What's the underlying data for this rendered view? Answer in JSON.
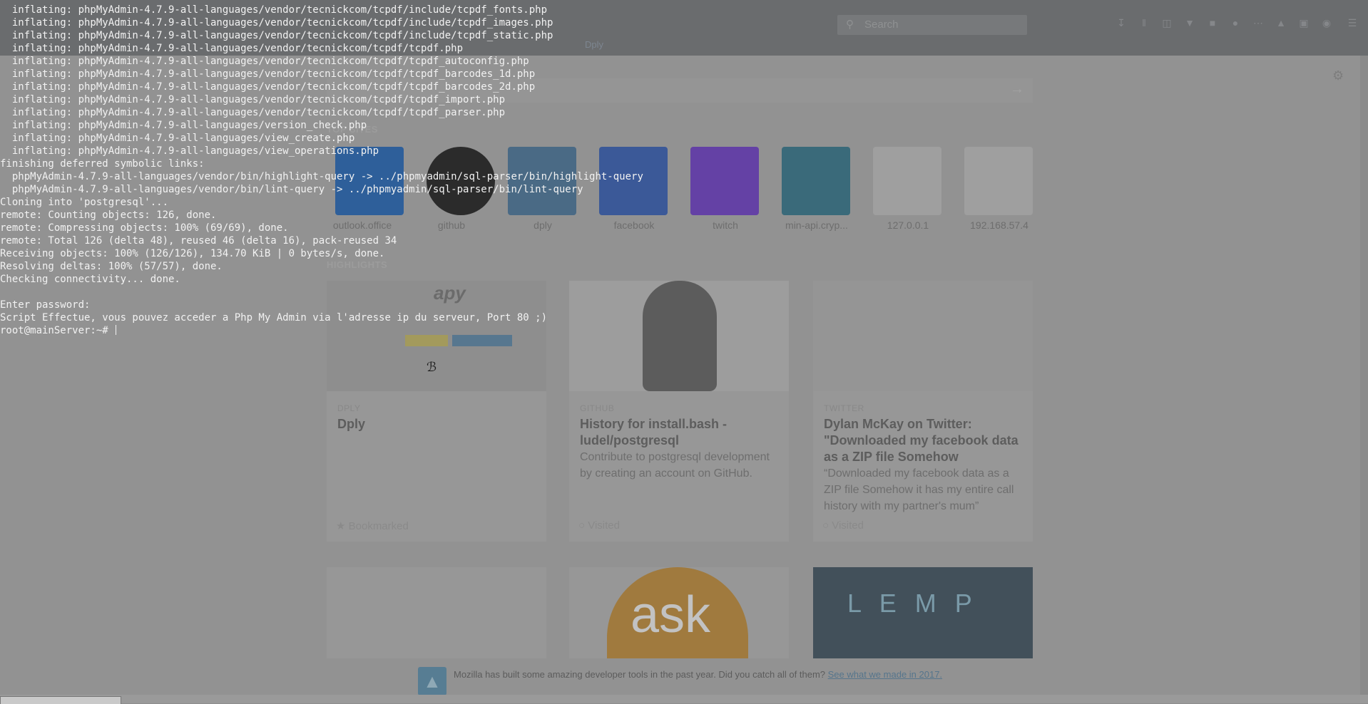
{
  "browser": {
    "search_placeholder": "Search",
    "tab_label": "Dply",
    "top_sites_heading": "TOP SITES",
    "highlights_heading": "HIGHLIGHTS",
    "top_sites": [
      {
        "label": "outlook.office",
        "color": "#2e5f9a"
      },
      {
        "label": "github",
        "color": "#2b2b2b"
      },
      {
        "label": "dply",
        "color": "#4a6a85"
      },
      {
        "label": "facebook",
        "color": "#3b5998"
      },
      {
        "label": "twitch",
        "color": "#6441a5"
      },
      {
        "label": "min-api.cryp...",
        "color": "#3a6a7a"
      },
      {
        "label": "127.0.0.1",
        "color": "#9f9f9f"
      },
      {
        "label": "192.168.57.4",
        "color": "#9f9f9f"
      }
    ],
    "highlights": [
      {
        "source": "DPLY",
        "title": "Dply",
        "description": "",
        "context": "Bookmarked",
        "thumb_text": "apy"
      },
      {
        "source": "GITHUB",
        "title": "History for install.bash - ludel/postgresql",
        "description": "Contribute to postgresql development by creating an account on GitHub.",
        "context": "Visited"
      },
      {
        "source": "TWITTER",
        "title": "Dylan McKay on Twitter: \"Downloaded my facebook data as a ZIP file Somehow",
        "description": "“Downloaded my facebook data as a ZIP file Somehow it has my entire call history with my partner's mum”",
        "context": "Visited"
      }
    ],
    "lower_tiles": [
      {
        "label": ""
      },
      {
        "label": "ask"
      },
      {
        "label": "L E M P"
      }
    ],
    "banner": {
      "message": "Mozilla has built some amazing developer tools in the past year. Did you catch all of them? ",
      "link": "See what we made in 2017."
    }
  },
  "terminal": {
    "lines": [
      "  inflating: phpMyAdmin-4.7.9-all-languages/vendor/tecnickcom/tcpdf/include/tcpdf_fonts.php",
      "  inflating: phpMyAdmin-4.7.9-all-languages/vendor/tecnickcom/tcpdf/include/tcpdf_images.php",
      "  inflating: phpMyAdmin-4.7.9-all-languages/vendor/tecnickcom/tcpdf/include/tcpdf_static.php",
      "  inflating: phpMyAdmin-4.7.9-all-languages/vendor/tecnickcom/tcpdf/tcpdf.php",
      "  inflating: phpMyAdmin-4.7.9-all-languages/vendor/tecnickcom/tcpdf/tcpdf_autoconfig.php",
      "  inflating: phpMyAdmin-4.7.9-all-languages/vendor/tecnickcom/tcpdf/tcpdf_barcodes_1d.php",
      "  inflating: phpMyAdmin-4.7.9-all-languages/vendor/tecnickcom/tcpdf/tcpdf_barcodes_2d.php",
      "  inflating: phpMyAdmin-4.7.9-all-languages/vendor/tecnickcom/tcpdf/tcpdf_import.php",
      "  inflating: phpMyAdmin-4.7.9-all-languages/vendor/tecnickcom/tcpdf/tcpdf_parser.php",
      "  inflating: phpMyAdmin-4.7.9-all-languages/version_check.php",
      "  inflating: phpMyAdmin-4.7.9-all-languages/view_create.php",
      "  inflating: phpMyAdmin-4.7.9-all-languages/view_operations.php",
      "finishing deferred symbolic links:",
      "  phpMyAdmin-4.7.9-all-languages/vendor/bin/highlight-query -> ../phpmyadmin/sql-parser/bin/highlight-query",
      "  phpMyAdmin-4.7.9-all-languages/vendor/bin/lint-query -> ../phpmyadmin/sql-parser/bin/lint-query",
      "Cloning into 'postgresql'...",
      "remote: Counting objects: 126, done.",
      "remote: Compressing objects: 100% (69/69), done.",
      "remote: Total 126 (delta 48), reused 46 (delta 16), pack-reused 34",
      "Receiving objects: 100% (126/126), 134.70 KiB | 0 bytes/s, done.",
      "Resolving deltas: 100% (57/57), done.",
      "Checking connectivity... done.",
      "",
      "Enter password:",
      "Script Effectue, vous pouvez acceder a Php My Admin via l'adresse ip du serveur, Port 80 ;)"
    ],
    "prompt": "root@mainServer:~# "
  }
}
